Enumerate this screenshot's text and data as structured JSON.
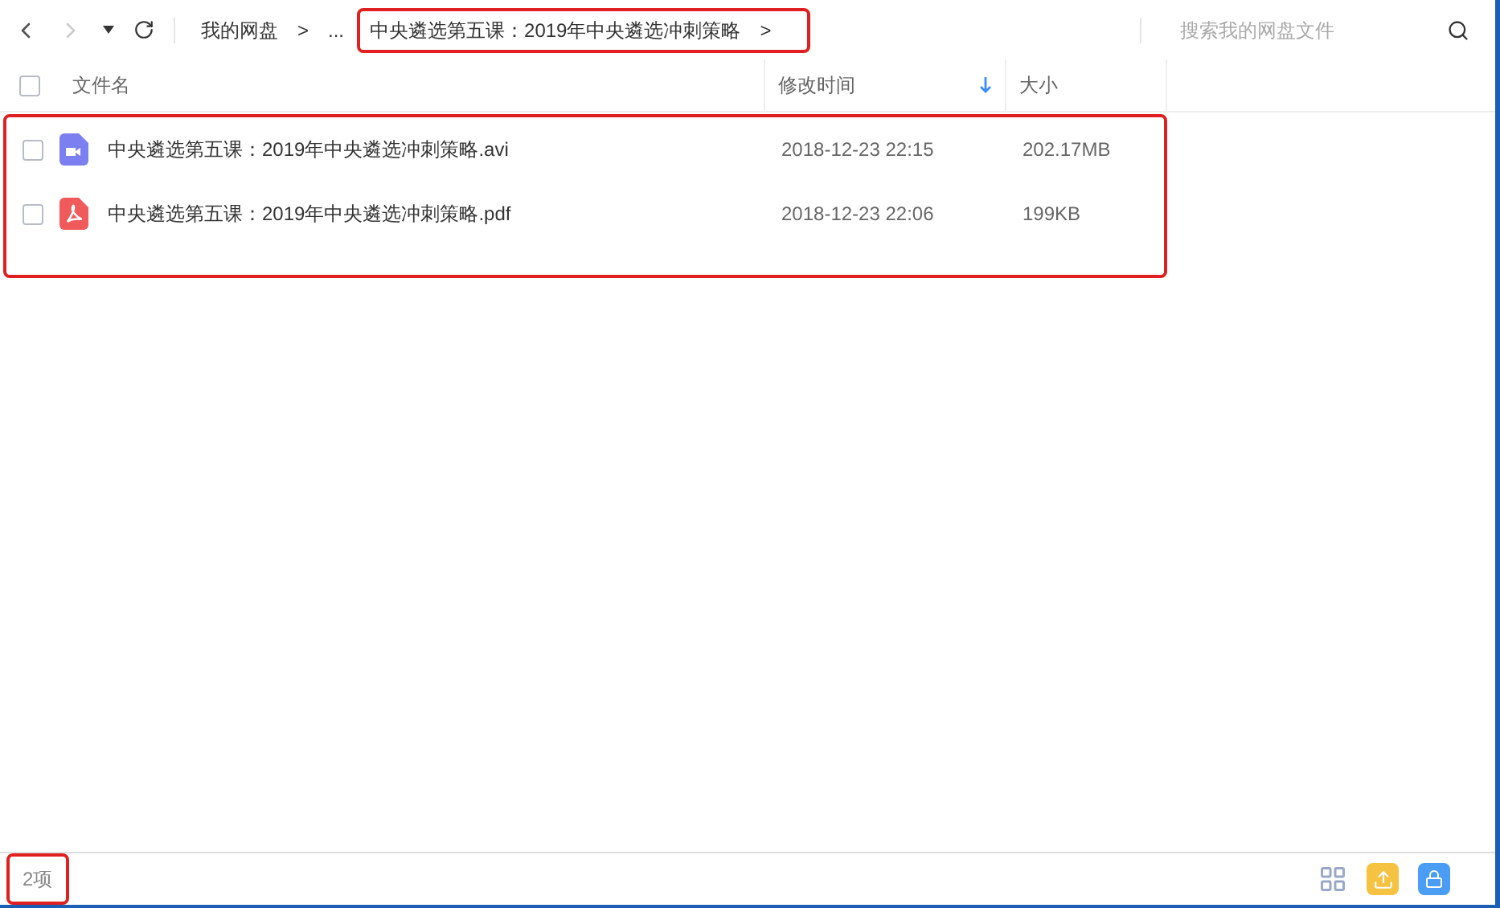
{
  "breadcrumb": {
    "items": [
      {
        "label": "我的网盘",
        "highlighted": false
      },
      {
        "label": "...",
        "highlighted": false
      },
      {
        "label": "中央遴选第五课：2019年中央遴选冲刺策略",
        "highlighted": true
      }
    ],
    "separator": ">"
  },
  "search": {
    "placeholder": "搜索我的网盘文件"
  },
  "select_all": {
    "checked": false
  },
  "columns": [
    {
      "label": "文件名",
      "sorted": false
    },
    {
      "label": "修改时间",
      "sorted": true
    },
    {
      "label": "大小",
      "sorted": false
    }
  ],
  "files_highlighted": true,
  "files": [
    {
      "kind": "video",
      "name": "中央遴选第五课：2019年中央遴选冲刺策略.avi",
      "modified": "2018-12-23 22:15",
      "size": "202.17MB",
      "selected": false
    },
    {
      "kind": "pdf",
      "name": "中央遴选第五课：2019年中央遴选冲刺策略.pdf",
      "modified": "2018-12-23 22:06",
      "size": "199KB",
      "selected": false
    }
  ],
  "status": {
    "count": "2项",
    "highlighted": true
  }
}
